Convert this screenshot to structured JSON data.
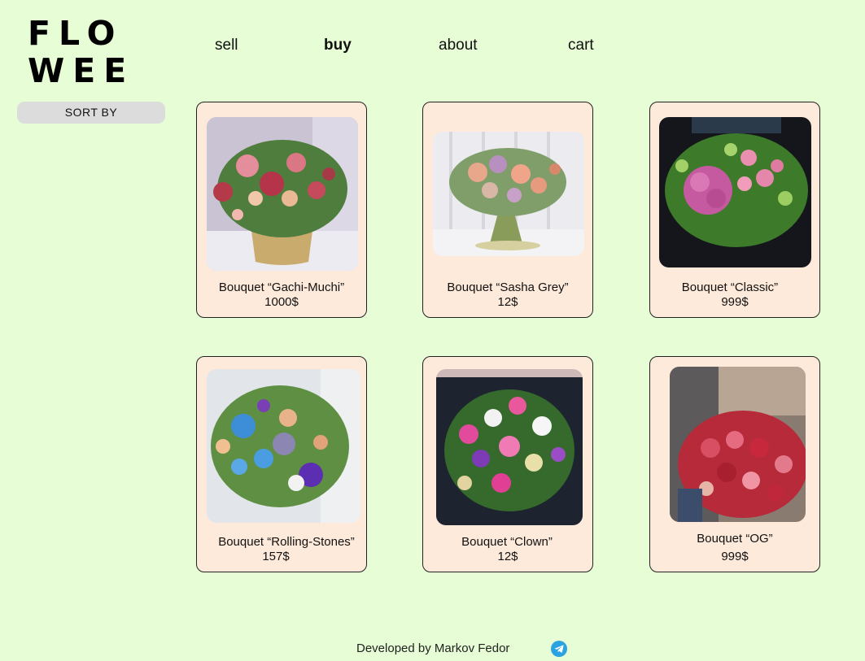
{
  "brand": {
    "line1": "FLO",
    "line2": "WEE"
  },
  "nav": {
    "sell": "sell",
    "buy": "buy",
    "about": "about",
    "cart": "cart"
  },
  "sidebar": {
    "sort_label": "SORT BY"
  },
  "products": [
    {
      "name": "Bouquet “Gachi-Muchi”",
      "price": "1000$",
      "icon": "bouquet-photo"
    },
    {
      "name": "Bouquet “Sasha Grey”",
      "price": "12$",
      "icon": "bouquet-photo"
    },
    {
      "name": "Bouquet “Classic”",
      "price": "999$",
      "icon": "bouquet-photo"
    },
    {
      "name": "Bouquet “Rolling-Stones”",
      "price": "157$",
      "icon": "bouquet-photo"
    },
    {
      "name": "Bouquet “Clown”",
      "price": "12$",
      "icon": "bouquet-photo"
    },
    {
      "name": "Bouquet “OG”",
      "price": "999$",
      "icon": "bouquet-photo"
    }
  ],
  "footer": {
    "credit": "Developed by Markov Fedor",
    "icon": "telegram-icon"
  },
  "colors": {
    "background": "#e6fdd5",
    "card": "#feeadb",
    "sort_button": "#dcdcdc",
    "telegram": "#2aa3e0"
  }
}
